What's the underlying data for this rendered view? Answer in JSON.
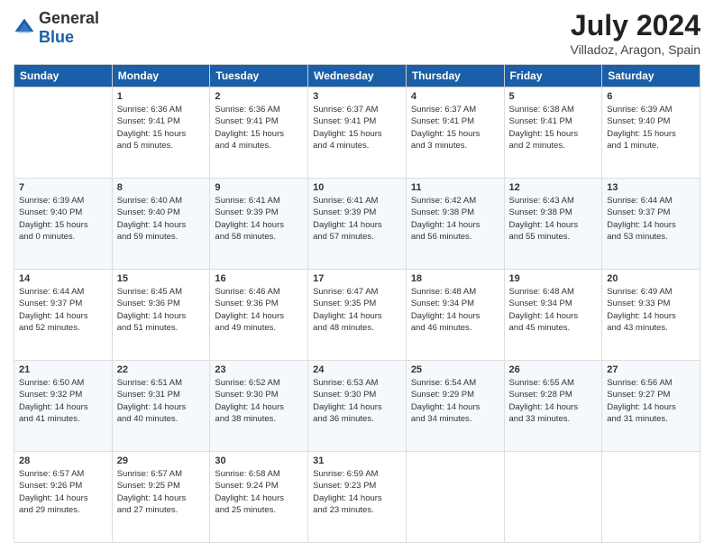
{
  "logo": {
    "general": "General",
    "blue": "Blue"
  },
  "title": {
    "month_year": "July 2024",
    "location": "Villadoz, Aragon, Spain"
  },
  "days_of_week": [
    "Sunday",
    "Monday",
    "Tuesday",
    "Wednesday",
    "Thursday",
    "Friday",
    "Saturday"
  ],
  "weeks": [
    [
      {
        "day": null,
        "data": null
      },
      {
        "day": "1",
        "data": "Sunrise: 6:36 AM\nSunset: 9:41 PM\nDaylight: 15 hours\nand 5 minutes."
      },
      {
        "day": "2",
        "data": "Sunrise: 6:36 AM\nSunset: 9:41 PM\nDaylight: 15 hours\nand 4 minutes."
      },
      {
        "day": "3",
        "data": "Sunrise: 6:37 AM\nSunset: 9:41 PM\nDaylight: 15 hours\nand 4 minutes."
      },
      {
        "day": "4",
        "data": "Sunrise: 6:37 AM\nSunset: 9:41 PM\nDaylight: 15 hours\nand 3 minutes."
      },
      {
        "day": "5",
        "data": "Sunrise: 6:38 AM\nSunset: 9:41 PM\nDaylight: 15 hours\nand 2 minutes."
      },
      {
        "day": "6",
        "data": "Sunrise: 6:39 AM\nSunset: 9:40 PM\nDaylight: 15 hours\nand 1 minute."
      }
    ],
    [
      {
        "day": "7",
        "data": "Sunrise: 6:39 AM\nSunset: 9:40 PM\nDaylight: 15 hours\nand 0 minutes."
      },
      {
        "day": "8",
        "data": "Sunrise: 6:40 AM\nSunset: 9:40 PM\nDaylight: 14 hours\nand 59 minutes."
      },
      {
        "day": "9",
        "data": "Sunrise: 6:41 AM\nSunset: 9:39 PM\nDaylight: 14 hours\nand 58 minutes."
      },
      {
        "day": "10",
        "data": "Sunrise: 6:41 AM\nSunset: 9:39 PM\nDaylight: 14 hours\nand 57 minutes."
      },
      {
        "day": "11",
        "data": "Sunrise: 6:42 AM\nSunset: 9:38 PM\nDaylight: 14 hours\nand 56 minutes."
      },
      {
        "day": "12",
        "data": "Sunrise: 6:43 AM\nSunset: 9:38 PM\nDaylight: 14 hours\nand 55 minutes."
      },
      {
        "day": "13",
        "data": "Sunrise: 6:44 AM\nSunset: 9:37 PM\nDaylight: 14 hours\nand 53 minutes."
      }
    ],
    [
      {
        "day": "14",
        "data": "Sunrise: 6:44 AM\nSunset: 9:37 PM\nDaylight: 14 hours\nand 52 minutes."
      },
      {
        "day": "15",
        "data": "Sunrise: 6:45 AM\nSunset: 9:36 PM\nDaylight: 14 hours\nand 51 minutes."
      },
      {
        "day": "16",
        "data": "Sunrise: 6:46 AM\nSunset: 9:36 PM\nDaylight: 14 hours\nand 49 minutes."
      },
      {
        "day": "17",
        "data": "Sunrise: 6:47 AM\nSunset: 9:35 PM\nDaylight: 14 hours\nand 48 minutes."
      },
      {
        "day": "18",
        "data": "Sunrise: 6:48 AM\nSunset: 9:34 PM\nDaylight: 14 hours\nand 46 minutes."
      },
      {
        "day": "19",
        "data": "Sunrise: 6:48 AM\nSunset: 9:34 PM\nDaylight: 14 hours\nand 45 minutes."
      },
      {
        "day": "20",
        "data": "Sunrise: 6:49 AM\nSunset: 9:33 PM\nDaylight: 14 hours\nand 43 minutes."
      }
    ],
    [
      {
        "day": "21",
        "data": "Sunrise: 6:50 AM\nSunset: 9:32 PM\nDaylight: 14 hours\nand 41 minutes."
      },
      {
        "day": "22",
        "data": "Sunrise: 6:51 AM\nSunset: 9:31 PM\nDaylight: 14 hours\nand 40 minutes."
      },
      {
        "day": "23",
        "data": "Sunrise: 6:52 AM\nSunset: 9:30 PM\nDaylight: 14 hours\nand 38 minutes."
      },
      {
        "day": "24",
        "data": "Sunrise: 6:53 AM\nSunset: 9:30 PM\nDaylight: 14 hours\nand 36 minutes."
      },
      {
        "day": "25",
        "data": "Sunrise: 6:54 AM\nSunset: 9:29 PM\nDaylight: 14 hours\nand 34 minutes."
      },
      {
        "day": "26",
        "data": "Sunrise: 6:55 AM\nSunset: 9:28 PM\nDaylight: 14 hours\nand 33 minutes."
      },
      {
        "day": "27",
        "data": "Sunrise: 6:56 AM\nSunset: 9:27 PM\nDaylight: 14 hours\nand 31 minutes."
      }
    ],
    [
      {
        "day": "28",
        "data": "Sunrise: 6:57 AM\nSunset: 9:26 PM\nDaylight: 14 hours\nand 29 minutes."
      },
      {
        "day": "29",
        "data": "Sunrise: 6:57 AM\nSunset: 9:25 PM\nDaylight: 14 hours\nand 27 minutes."
      },
      {
        "day": "30",
        "data": "Sunrise: 6:58 AM\nSunset: 9:24 PM\nDaylight: 14 hours\nand 25 minutes."
      },
      {
        "day": "31",
        "data": "Sunrise: 6:59 AM\nSunset: 9:23 PM\nDaylight: 14 hours\nand 23 minutes."
      },
      {
        "day": null,
        "data": null
      },
      {
        "day": null,
        "data": null
      },
      {
        "day": null,
        "data": null
      }
    ]
  ]
}
